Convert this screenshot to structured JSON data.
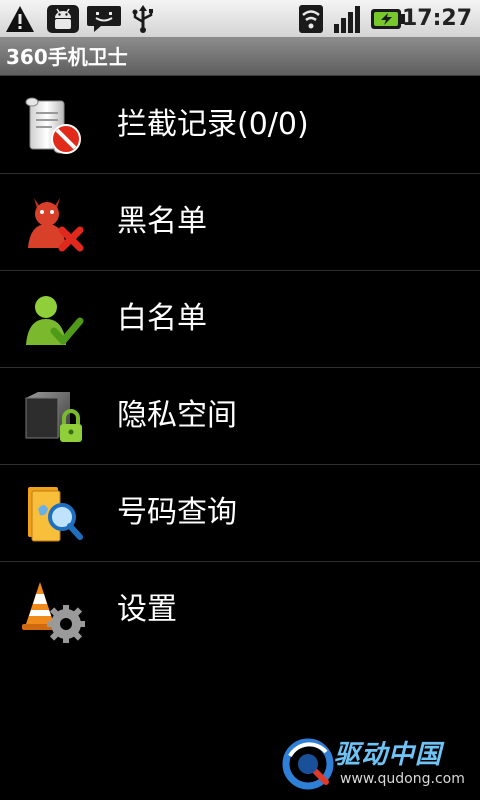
{
  "status_bar": {
    "time": "17:27",
    "icons": [
      "warning-icon",
      "android-icon",
      "message-icon",
      "usb-icon",
      "wifi-icon",
      "signal-icon",
      "battery-icon"
    ]
  },
  "app": {
    "title": "360手机卫士"
  },
  "menu": {
    "items": [
      {
        "label": "拦截记录(0/0)",
        "icon": "blocked-log-icon"
      },
      {
        "label": "黑名单",
        "icon": "blacklist-icon"
      },
      {
        "label": "白名单",
        "icon": "whitelist-icon"
      },
      {
        "label": "隐私空间",
        "icon": "privacy-space-icon"
      },
      {
        "label": "号码查询",
        "icon": "number-lookup-icon"
      },
      {
        "label": "设置",
        "icon": "settings-icon"
      }
    ]
  },
  "watermark": {
    "brand": "驱动中国",
    "url": "www.qudong.com"
  },
  "colors": {
    "background": "#000000",
    "title_bar": "#6f6f6f",
    "divider": "#2e2e2e",
    "text": "#ffffff",
    "watermark_blue": "#6fc3f5"
  }
}
